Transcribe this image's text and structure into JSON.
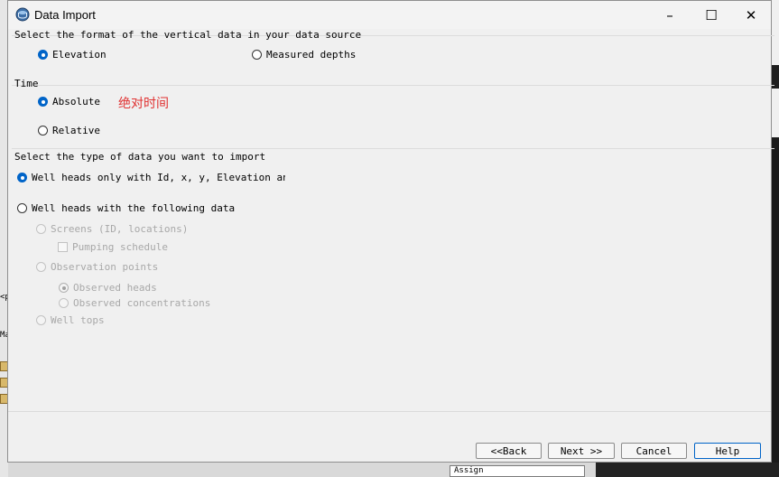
{
  "window": {
    "title": "Data Import",
    "icon": "data-import-app-icon",
    "minimize": "–",
    "maximize": "☐",
    "close": "✕"
  },
  "vertical": {
    "label": "Select the format of the vertical data in your data source",
    "options": [
      "Elevation",
      "Measured depths"
    ],
    "selected": "Elevation"
  },
  "time": {
    "label": "Time",
    "options": [
      "Absolute",
      "Relative"
    ],
    "selected": "Absolute",
    "annotation": "绝对时间",
    "annotation_color": "#e03030"
  },
  "data_type": {
    "label": "Select the type of data you want to import",
    "option_heads_only": "Well heads only with Id, x, y, Elevation and de",
    "option_heads_with": "Well heads with the following data",
    "selected": "Well heads only with Id, x, y, Elevation and de",
    "screens": "Screens (ID, locations)",
    "pumping_schedule": "Pumping schedule",
    "observation_points": "Observation points",
    "observed_heads": "Observed heads",
    "observed_concentrations": "Observed concentrations",
    "well_tops": "Well tops"
  },
  "buttons": {
    "back": "<<Back",
    "next": "Next >>",
    "cancel": "Cancel",
    "help": "Help"
  },
  "background": {
    "fragment_1": "<p",
    "fragment_2": "Ma",
    "bottom_field": "Assign"
  },
  "colors": {
    "accent": "#0064c8",
    "annotation": "#e03030"
  }
}
